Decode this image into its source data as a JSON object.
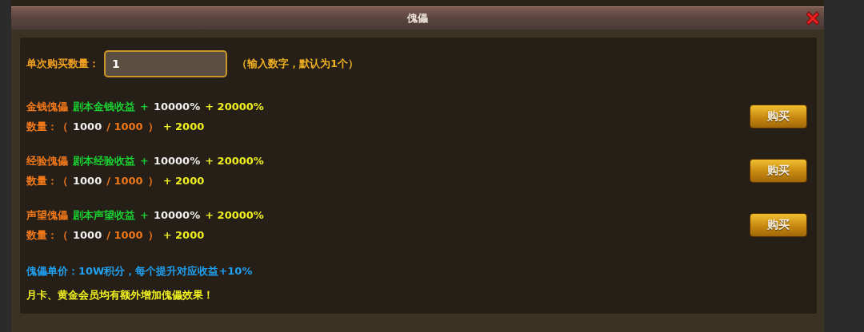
{
  "dialog": {
    "title": "傀儡"
  },
  "quantity": {
    "label": "单次购买数量：",
    "value": "1",
    "hint": "（输入数字，默认为1个）"
  },
  "items": [
    {
      "name": "金钱傀儡",
      "effect": "剧本金钱收益",
      "effect_plus": "+",
      "base": "10000%",
      "extra": "+ 20000%",
      "count_label": "数量：（",
      "count": "1000",
      "max": "/ 1000",
      "count_close": "）",
      "count_extra": "+ 2000",
      "button": "购买"
    },
    {
      "name": "经验傀儡",
      "effect": "剧本经验收益",
      "effect_plus": "+",
      "base": "10000%",
      "extra": "+ 20000%",
      "count_label": "数量：（",
      "count": "1000",
      "max": "/ 1000",
      "count_close": "）",
      "count_extra": "+ 2000",
      "button": "购买"
    },
    {
      "name": "声望傀儡",
      "effect": "剧本声望收益",
      "effect_plus": "+",
      "base": "10000%",
      "extra": "+ 20000%",
      "count_label": "数量：（",
      "count": "1000",
      "max": "/ 1000",
      "count_close": "）",
      "count_extra": "+ 2000",
      "button": "购买"
    }
  ],
  "price_note": "傀儡单价：10W积分，每个提升对应收益+10%",
  "member_note": "月卡、黄金会员均有额外增加傀儡效果！"
}
